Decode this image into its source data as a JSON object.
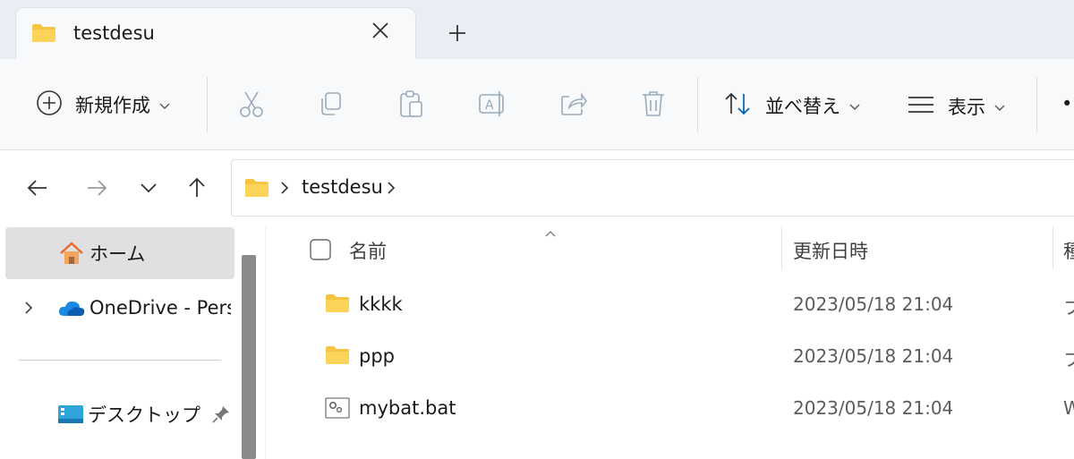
{
  "window": {
    "tab_title": "testdesu"
  },
  "toolbar": {
    "new_label": "新規作成",
    "sort_label": "並べ替え",
    "view_label": "表示",
    "more_label": "•"
  },
  "address": {
    "segments": [
      "testdesu"
    ]
  },
  "sidebar": {
    "items": [
      {
        "label": "ホーム",
        "icon": "home-icon"
      },
      {
        "label": "OneDrive - Perso",
        "icon": "onedrive-icon"
      },
      {
        "label": "デスクトップ",
        "icon": "desktop-icon"
      }
    ]
  },
  "columns": {
    "name": "名前",
    "date": "更新日時",
    "type": "種"
  },
  "files": [
    {
      "name": "kkkk",
      "date": "2023/05/18 21:04",
      "type": "フ",
      "icon": "folder-icon"
    },
    {
      "name": "ppp",
      "date": "2023/05/18 21:04",
      "type": "フ",
      "icon": "folder-icon"
    },
    {
      "name": "mybat.bat",
      "date": "2023/05/18 21:04",
      "type": "W",
      "icon": "batch-file-icon"
    }
  ],
  "colors": {
    "folder": "#f5c542",
    "accent": "#0063b1",
    "selected_bg": "#e0e0e0"
  }
}
